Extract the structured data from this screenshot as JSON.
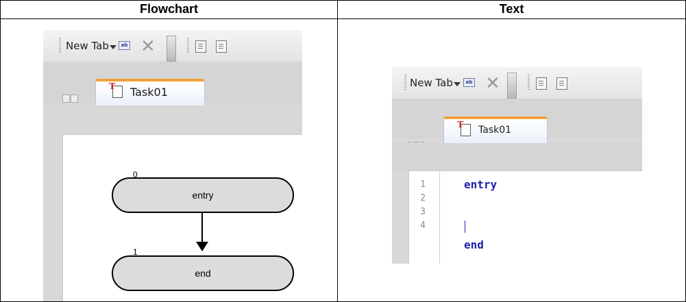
{
  "table": {
    "headers": [
      "Flowchart",
      "Text"
    ]
  },
  "toolbar": {
    "new_tab_label": "New Tab"
  },
  "tab": {
    "label": "Task01"
  },
  "flowchart": {
    "nodes": [
      {
        "id": "0",
        "label": "entry"
      },
      {
        "id": "1",
        "label": "end"
      }
    ]
  },
  "editor": {
    "line_numbers": [
      "1",
      "2",
      "3",
      "4"
    ],
    "lines": [
      "entry",
      "",
      "",
      "end"
    ]
  },
  "colors": {
    "tab_accent": "#f0a23c",
    "keyword": "#1f1fa8",
    "node_fill": "#dcdcdc"
  }
}
